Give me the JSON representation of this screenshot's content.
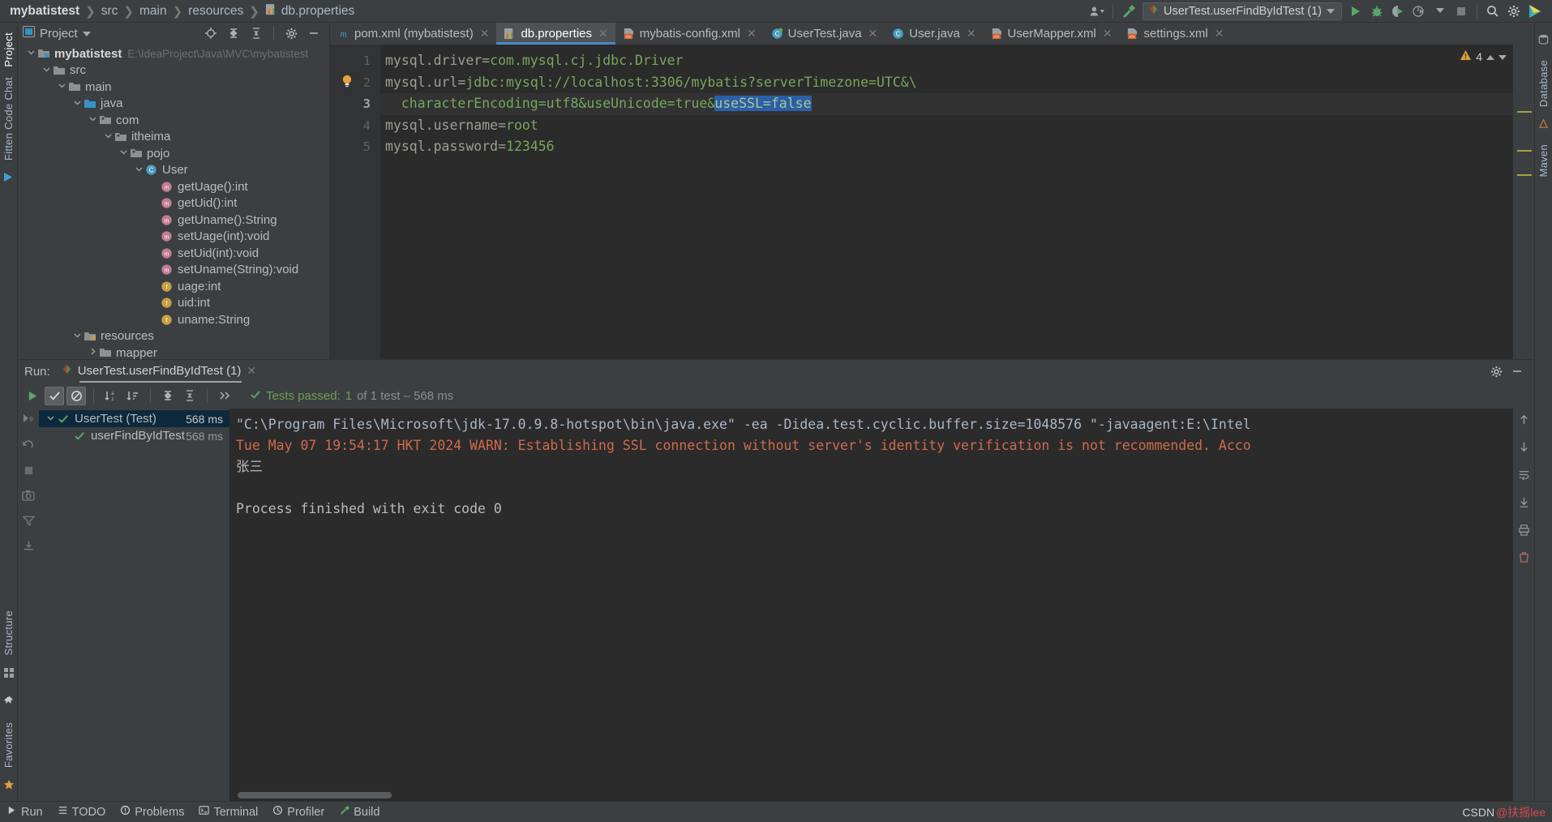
{
  "window": {
    "breadcrumbs": [
      "mybatistest",
      "src",
      "main",
      "resources",
      "db.properties"
    ],
    "run_config": "UserTest.userFindByIdTest (1)"
  },
  "left_rail": {
    "tabs": [
      "Project",
      "Fitten Code Chat",
      "Structure",
      "Favorites"
    ]
  },
  "right_rail": {
    "tabs": [
      "Database",
      "Maven"
    ]
  },
  "project_panel": {
    "title": "Project",
    "tools": [
      "locate-icon",
      "expand-all-icon",
      "collapse-all-icon",
      "gear-icon",
      "minimize-icon"
    ],
    "tree": [
      {
        "depth": 0,
        "chevron": "down",
        "icon": "module-icon",
        "label": "mybatistest",
        "bold": true,
        "path": "E:\\IdeaProject\\Java\\MVC\\mybatistest"
      },
      {
        "depth": 1,
        "chevron": "down",
        "icon": "folder-icon",
        "label": "src"
      },
      {
        "depth": 2,
        "chevron": "down",
        "icon": "folder-icon",
        "label": "main"
      },
      {
        "depth": 3,
        "chevron": "down",
        "icon": "source-root-icon",
        "label": "java"
      },
      {
        "depth": 4,
        "chevron": "down",
        "icon": "package-icon",
        "label": "com"
      },
      {
        "depth": 5,
        "chevron": "down",
        "icon": "package-icon",
        "label": "itheima"
      },
      {
        "depth": 6,
        "chevron": "down",
        "icon": "package-icon",
        "label": "pojo"
      },
      {
        "depth": 7,
        "chevron": "down",
        "icon": "class-icon",
        "label": "User"
      },
      {
        "depth": 8,
        "chevron": "none",
        "icon": "method-icon",
        "label": "getUage():int"
      },
      {
        "depth": 8,
        "chevron": "none",
        "icon": "method-icon",
        "label": "getUid():int"
      },
      {
        "depth": 8,
        "chevron": "none",
        "icon": "method-icon",
        "label": "getUname():String"
      },
      {
        "depth": 8,
        "chevron": "none",
        "icon": "method-icon",
        "label": "setUage(int):void"
      },
      {
        "depth": 8,
        "chevron": "none",
        "icon": "method-icon",
        "label": "setUid(int):void"
      },
      {
        "depth": 8,
        "chevron": "none",
        "icon": "method-icon",
        "label": "setUname(String):void"
      },
      {
        "depth": 8,
        "chevron": "none",
        "icon": "field-icon",
        "label": "uage:int"
      },
      {
        "depth": 8,
        "chevron": "none",
        "icon": "field-icon",
        "label": "uid:int"
      },
      {
        "depth": 8,
        "chevron": "none",
        "icon": "field-icon",
        "label": "uname:String"
      },
      {
        "depth": 3,
        "chevron": "down",
        "icon": "resource-root-icon",
        "label": "resources"
      },
      {
        "depth": 4,
        "chevron": "right",
        "icon": "folder-icon",
        "label": "mapper"
      }
    ]
  },
  "editor": {
    "tabs": [
      {
        "label": "pom.xml (mybatistest)",
        "icon": "maven-icon",
        "active": false
      },
      {
        "label": "db.properties",
        "icon": "properties-icon",
        "active": true
      },
      {
        "label": "mybatis-config.xml",
        "icon": "xml-icon",
        "active": false
      },
      {
        "label": "UserTest.java",
        "icon": "testclass-icon",
        "active": false
      },
      {
        "label": "User.java",
        "icon": "class-icon",
        "active": false
      },
      {
        "label": "UserMapper.xml",
        "icon": "xml-icon",
        "active": false
      },
      {
        "label": "settings.xml",
        "icon": "xml-icon",
        "active": false
      }
    ],
    "warning_count": "4",
    "lines": [
      {
        "num": "1",
        "key": "mysql.driver=",
        "value": "com.mysql.cj.jdbc.Driver",
        "current": false
      },
      {
        "num": "2",
        "key": "mysql.url=",
        "value": "jdbc:mysql://localhost:3306/mybatis?serverTimezone=UTC&\\",
        "current": false
      },
      {
        "num": "3",
        "key": "",
        "value_pre": "  characterEncoding=utf8&useUnicode=true&",
        "value_sel": "useSSL=false",
        "current": true
      },
      {
        "num": "4",
        "key": "mysql.username=",
        "value": "root",
        "current": false
      },
      {
        "num": "5",
        "key": "mysql.password=",
        "value": "123456",
        "current": false
      }
    ]
  },
  "run_panel": {
    "label": "Run:",
    "tab": "UserTest.userFindByIdTest (1)",
    "toolbar_icons": [
      "rerun-icon",
      "show-passed-icon",
      "show-ignored-icon",
      "sort-alpha-icon",
      "sort-duration-icon",
      "expand-all-icon",
      "collapse-all-icon",
      "more-icon"
    ],
    "status_prefix": "Tests passed:",
    "status_count": "1",
    "status_suffix": "of 1 test – 568 ms",
    "tests": [
      {
        "depth": 0,
        "chevron": "down",
        "label": "UserTest (Test)",
        "time": "568 ms",
        "selected": true
      },
      {
        "depth": 1,
        "chevron": "none",
        "label": "userFindByIdTest",
        "time": "568 ms",
        "selected": false
      }
    ],
    "console": [
      {
        "type": "sys",
        "text": "\"C:\\Program Files\\Microsoft\\jdk-17.0.9.8-hotspot\\bin\\java.exe\" -ea -Didea.test.cyclic.buffer.size=1048576 \"-javaagent:E:\\Intel"
      },
      {
        "type": "err",
        "text": "Tue May 07 19:54:17 HKT 2024 WARN: Establishing SSL connection without server's identity verification is not recommended. Acco"
      },
      {
        "type": "out",
        "text": "张三"
      },
      {
        "type": "out",
        "text": ""
      },
      {
        "type": "out",
        "text": "Process finished with exit code 0"
      }
    ],
    "console_rail_icons": [
      "scroll-up-icon",
      "scroll-down-icon",
      "soft-wrap-icon",
      "scroll-to-end-icon",
      "print-icon",
      "clear-all-icon"
    ]
  },
  "status_bar": {
    "items": [
      {
        "icon": "run-icon",
        "label": "Run"
      },
      {
        "icon": "todo-icon",
        "label": "TODO"
      },
      {
        "icon": "problems-icon",
        "label": "Problems"
      },
      {
        "icon": "terminal-icon",
        "label": "Terminal"
      },
      {
        "icon": "profiler-icon",
        "label": "Profiler"
      },
      {
        "icon": "build-icon",
        "label": "Build"
      }
    ],
    "watermark_brand": "CSDN",
    "watermark_user": "@扶摇lee"
  },
  "colors": {
    "accent_blue": "#4a88c7",
    "selection_blue": "#2b5fa8",
    "value_green": "#77a75c",
    "error_red": "#cf6a4c",
    "pass_green": "#6a9e56",
    "panel_bg": "#3c3f41",
    "editor_bg": "#2b2b2b"
  }
}
